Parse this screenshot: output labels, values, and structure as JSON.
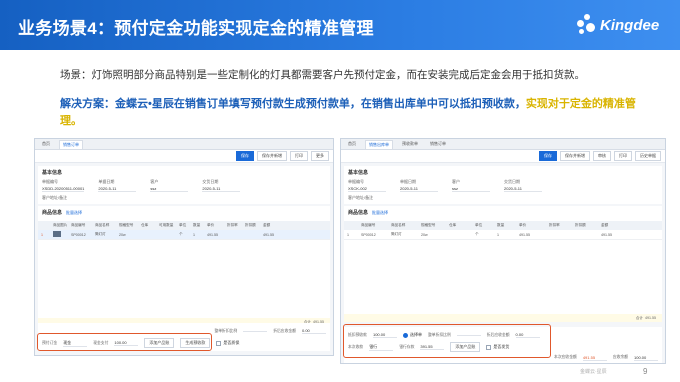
{
  "header": {
    "title": "业务场景4：预付定金功能实现定金的精准管理",
    "logo_text": "Kingdee"
  },
  "scenario": "场景：灯饰照明部分商品特别是一些定制化的灯具都需要客户先预付定金，而在安装完成后定金会用于抵扣货款。",
  "solution": {
    "lead": "解决方案：金蝶云•星辰在销售订单填写预付款生成预付款单，在销售出库单中可以抵扣预收款，",
    "highlight": "实现对于定金的精准管理。"
  },
  "left_shot": {
    "tabs": [
      "首页",
      "销售订单"
    ],
    "toolbar": [
      "保存",
      "保存并新增",
      "打印",
      "更多"
    ],
    "section_title": "基本信息",
    "fields": [
      {
        "label": "单据编号",
        "value": "XSDD-20200511-00001"
      },
      {
        "label": "单据日期",
        "value": "2020-5-11"
      },
      {
        "label": "客户",
        "value": "ssz"
      },
      {
        "label": "交货日期",
        "value": "2020-5-11"
      }
    ],
    "remark_label": "客户地址/备注",
    "goods_title": "商品信息",
    "goods_link": "批量选择",
    "grid_headers": [
      "",
      "商品图片",
      "商品编号",
      "商品名称",
      "规格型号",
      "仓库",
      "可用数量",
      "单位",
      "数量",
      "单价",
      "折扣率",
      "折扣额",
      "金额"
    ],
    "grid_row": [
      "1",
      "",
      "SP00012",
      "筒灯灯",
      "20w",
      "",
      "",
      "个",
      "1",
      "491.55",
      "",
      "",
      "491.55"
    ],
    "total_label": "合计",
    "total_value": "491.55",
    "discount_label": "整单折扣比例",
    "after_discount_label": "折后应收金额",
    "after_discount_value": "0.00",
    "payment_row": {
      "method_label": "预付订金",
      "method_value": "现金",
      "amount_label": "现金支付",
      "amount_value": "100.00",
      "btn_add": "添加产品账",
      "btn_gen": "生成预收款",
      "check_label": "是否质保"
    }
  },
  "right_shot": {
    "tabs": [
      "首页",
      "销售出库单",
      "预收款单",
      "销售订单"
    ],
    "toolbar": [
      "保存",
      "保存并新增",
      "审核",
      "打印",
      "历史单据"
    ],
    "section_title": "基本信息",
    "fields": [
      {
        "label": "单据编号",
        "value": "XSCK-002"
      },
      {
        "label": "单据日期",
        "value": "2020-5-11"
      },
      {
        "label": "客户",
        "value": "ssz"
      },
      {
        "label": "交货日期",
        "value": "2020-5-11"
      }
    ],
    "remark_label": "客户地址/备注",
    "goods_title": "商品信息",
    "goods_link": "批量选择",
    "grid_headers": [
      "",
      "商品编号",
      "商品名称",
      "规格型号",
      "仓库",
      "单位",
      "数量",
      "单价",
      "折扣率",
      "折扣额",
      "金额"
    ],
    "grid_row": [
      "1",
      "SP00012",
      "筒灯灯",
      "20w",
      "",
      "个",
      "1",
      "491.55",
      "",
      "",
      "491.55"
    ],
    "total_label": "合计",
    "total_value": "491.55",
    "deduct_row": {
      "label": "抵扣预收款",
      "value": "100.00",
      "check_label": "选择单",
      "discount_label": "整单折扣比例",
      "after_label": "折后应收金额",
      "after_value": "0.00"
    },
    "receive_row": {
      "method_label": "本次收款",
      "method_value": "银行",
      "amount_label": "银行存款",
      "amount_value": "391.55",
      "btn_add": "添加产品账",
      "check_label": "是否发货"
    },
    "summary": {
      "label": "本次应收金额",
      "value": "491.55",
      "due_label": "应收余额",
      "due_value": "100.00"
    }
  },
  "footer": {
    "watermark": "金蝶云·星辰",
    "page_number": "9"
  },
  "colors": {
    "header_blue": "#1560c2",
    "solution_blue": "#1c5fb8",
    "highlight_yellow": "#d9b400",
    "box_orange": "#e0582c"
  }
}
